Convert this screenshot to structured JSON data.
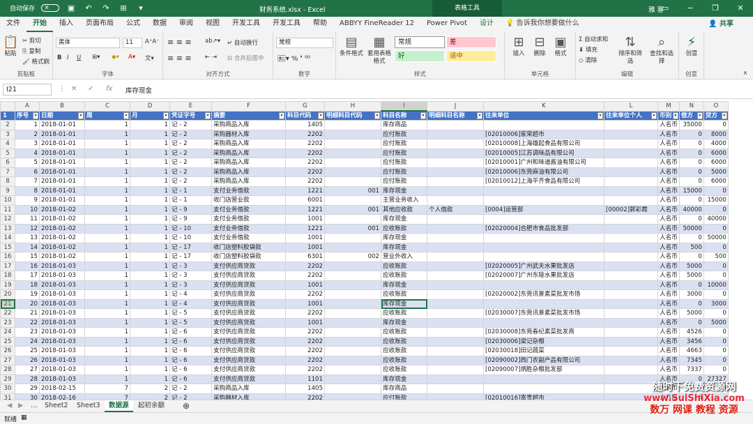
{
  "titlebar": {
    "autosave": "自动保存",
    "autosave_state": "关",
    "title": "财务系统.xlsx - Excel",
    "context": "表格工具",
    "user": "雅 客"
  },
  "tabs": [
    "文件",
    "开始",
    "插入",
    "页面布局",
    "公式",
    "数据",
    "审阅",
    "视图",
    "开发工具",
    "开发工具",
    "帮助",
    "ABBYY FineReader 12",
    "Power Pivot",
    "设计"
  ],
  "tellme": "告诉我你想要做什么",
  "share": "共享",
  "ribbon": {
    "clipboard": {
      "label": "剪贴板",
      "paste": "粘贴",
      "cut": "剪切",
      "copy": "复制",
      "painter": "格式刷"
    },
    "font": {
      "label": "字体",
      "name": "黑体",
      "size": "11",
      "bold": "B",
      "italic": "I",
      "underline": "U"
    },
    "align": {
      "label": "对齐方式",
      "wrap": "自动换行",
      "merge": "合并后居中"
    },
    "number": {
      "label": "数字",
      "format": "常规"
    },
    "styles": {
      "label": "样式",
      "cond": "条件格式",
      "table": "套用表格格式",
      "normal": "常规",
      "bad": "差",
      "good": "好",
      "neutral": "适中"
    },
    "cells": {
      "label": "单元格",
      "insert": "插入",
      "delete": "删除",
      "format": "格式"
    },
    "edit": {
      "label": "编辑",
      "autosum": "自动求和",
      "fill": "填充",
      "clear": "清除",
      "sort": "排序和筛选",
      "find": "查找和选择"
    },
    "idea": {
      "label": "创意",
      "btn": "创意"
    }
  },
  "formula": {
    "namebox": "I21",
    "content": "库存现金"
  },
  "columns": [
    "A",
    "B",
    "C",
    "D",
    "E",
    "F",
    "G",
    "H",
    "I",
    "J",
    "K",
    "L",
    "M",
    "N",
    "O"
  ],
  "selected_col": "I",
  "selected_row": 21,
  "headers": [
    "序号",
    "日期",
    "周",
    "月",
    "凭证字号",
    "摘要",
    "科目代码",
    "明细科目代码",
    "科目名称",
    "明细科目名称",
    "往来单位",
    "往来单位个人",
    "币别",
    "借方",
    "贷方"
  ],
  "rows": [
    [
      "1",
      "2018-01-01",
      "1",
      "1",
      "记 - 2",
      "采购商品入库",
      "1405",
      "",
      "库存商品",
      "",
      "",
      "",
      "人名币",
      "35000",
      "0"
    ],
    [
      "2",
      "2018-01-01",
      "1",
      "1",
      "记 - 2",
      "采购器材入库",
      "2202",
      "",
      "应付账款",
      "",
      "[02010006]家荣超市",
      "",
      "人名币",
      "0",
      "8000"
    ],
    [
      "3",
      "2018-01-01",
      "1",
      "1",
      "记 - 2",
      "采购商品入库",
      "2202",
      "",
      "应付账款",
      "",
      "[02010008]上海雄起食品有限公司",
      "",
      "人名币",
      "0",
      "4000"
    ],
    [
      "4",
      "2018-01-01",
      "1",
      "1",
      "记 - 2",
      "采购商品入库",
      "2202",
      "",
      "应付账款",
      "",
      "[02010005]江苏调味品有限公司",
      "",
      "人名币",
      "0",
      "6000"
    ],
    [
      "5",
      "2018-01-01",
      "1",
      "1",
      "记 - 2",
      "采购商品入库",
      "2202",
      "",
      "应付账款",
      "",
      "[02010001]广州和味道酱油有限公司",
      "",
      "人名币",
      "0",
      "6000"
    ],
    [
      "6",
      "2018-01-01",
      "1",
      "1",
      "记 - 2",
      "采购商品入库",
      "2202",
      "",
      "应付账款",
      "",
      "[02010006]东莞麻油有限公司",
      "",
      "人名币",
      "0",
      "5000"
    ],
    [
      "7",
      "2018-01-01",
      "1",
      "1",
      "记 - 2",
      "采购商品入库",
      "2202",
      "",
      "应付账款",
      "",
      "[02010012]上海平齐食品有限公司",
      "",
      "人名币",
      "0",
      "6000"
    ],
    [
      "8",
      "2018-01-01",
      "1",
      "1",
      "记 - 1",
      "支付业务借款",
      "1221",
      "001",
      "库存现金",
      "",
      "",
      "",
      "人名币",
      "15000",
      "0"
    ],
    [
      "9",
      "2018-01-01",
      "1",
      "1",
      "记 - 1",
      "收门店营业款",
      "6001",
      "",
      "主营业务收入",
      "",
      "",
      "",
      "人名币",
      "0",
      "15000"
    ],
    [
      "10",
      "2018-01-02",
      "1",
      "1",
      "记 - 9",
      "支付业务借款",
      "1221",
      "001",
      "其他应收款",
      "个人借款",
      "[0004]运营部",
      "[00002]郭彩霞",
      "人名币",
      "40000",
      "0"
    ],
    [
      "11",
      "2018-01-02",
      "1",
      "1",
      "记 - 9",
      "支付业务借款",
      "1001",
      "",
      "库存现金",
      "",
      "",
      "",
      "人名币",
      "0",
      "40000"
    ],
    [
      "12",
      "2018-01-02",
      "1",
      "1",
      "记 - 10",
      "支付业务借款",
      "1221",
      "001",
      "应收账款",
      "",
      "[02020004]合肥市食品批发部",
      "",
      "人名币",
      "50000",
      "0"
    ],
    [
      "13",
      "2018-01-02",
      "1",
      "1",
      "记 - 10",
      "支付业务借款",
      "1001",
      "",
      "库存现金",
      "",
      "",
      "",
      "人名币",
      "0",
      "50000"
    ],
    [
      "14",
      "2018-01-02",
      "1",
      "1",
      "记 - 17",
      "收门店塑料胶袋款",
      "1001",
      "",
      "库存现金",
      "",
      "",
      "",
      "人名币",
      "500",
      "0"
    ],
    [
      "15",
      "2018-01-02",
      "1",
      "1",
      "记 - 17",
      "收门店塑料胶袋款",
      "6301",
      "002",
      "营业外收入",
      "",
      "",
      "",
      "人名币",
      "0",
      "500"
    ],
    [
      "16",
      "2018-01-03",
      "1",
      "1",
      "记 - 3",
      "支付供应商贷款",
      "2202",
      "",
      "应收账款",
      "",
      "[02020005]广州武夫水果批发店",
      "",
      "人名币",
      "5000",
      "0"
    ],
    [
      "17",
      "2018-01-03",
      "1",
      "1",
      "记 - 3",
      "支付供应商贷款",
      "2202",
      "",
      "应收账款",
      "",
      "[02020007]广州东陵水果批发店",
      "",
      "人名币",
      "5000",
      "0"
    ],
    [
      "18",
      "2018-01-03",
      "1",
      "1",
      "记 - 3",
      "支付供应商贷款",
      "1001",
      "",
      "库存现金",
      "",
      "",
      "",
      "人名币",
      "0",
      "10000"
    ],
    [
      "19",
      "2018-01-03",
      "1",
      "1",
      "记 - 4",
      "支付供应商贷款",
      "2202",
      "",
      "应收账款",
      "",
      "[02020002]东莞讯景素菜批发市场",
      "",
      "人名币",
      "3000",
      "0"
    ],
    [
      "20",
      "2018-01-03",
      "1",
      "1",
      "记 - 4",
      "支付供应商贷款",
      "1001",
      "",
      "库存现金",
      "",
      "",
      "",
      "人名币",
      "0",
      "3000"
    ],
    [
      "21",
      "2018-01-03",
      "1",
      "1",
      "记 - 5",
      "支付供应商贷款",
      "2202",
      "",
      "应收账款",
      "",
      "[02030007]东莞讯景素菜批发市场",
      "",
      "人名币",
      "5000",
      "0"
    ],
    [
      "22",
      "2018-01-03",
      "1",
      "1",
      "记 - 5",
      "支付供应商贷款",
      "1001",
      "",
      "库存现金",
      "",
      "",
      "",
      "人名币",
      "0",
      "5000"
    ],
    [
      "23",
      "2018-01-03",
      "1",
      "1",
      "记 - 6",
      "支付供应商贷款",
      "2202",
      "",
      "应收账款",
      "",
      "[02030008]东莞春纪素菜批发商",
      "",
      "人名币",
      "4526",
      "0"
    ],
    [
      "24",
      "2018-01-03",
      "1",
      "1",
      "记 - 6",
      "支付供应商贷款",
      "2202",
      "",
      "应收账款",
      "",
      "[02030006]梁记杂粮",
      "",
      "人名币",
      "3456",
      "0"
    ],
    [
      "25",
      "2018-01-03",
      "1",
      "1",
      "记 - 6",
      "支付供应商贷款",
      "2202",
      "",
      "应收账款",
      "",
      "[02030018]田记蔬菜",
      "",
      "人名币",
      "4663",
      "0"
    ],
    [
      "26",
      "2018-01-03",
      "1",
      "1",
      "记 - 6",
      "支付供应商贷款",
      "2202",
      "",
      "应收账款",
      "",
      "[02090002]西门农副产品有限公司",
      "",
      "人名币",
      "7345",
      "0"
    ],
    [
      "27",
      "2018-01-03",
      "1",
      "1",
      "记 - 6",
      "支付供应商贷款",
      "2202",
      "",
      "应收账款",
      "",
      "[02090007]炳胜杂粮批发部",
      "",
      "人名币",
      "7337",
      "0"
    ],
    [
      "28",
      "2018-01-03",
      "1",
      "1",
      "记 - 6",
      "支付供应商贷款",
      "1101",
      "",
      "库存现金",
      "",
      "",
      "",
      "人名币",
      "0",
      "27327"
    ],
    [
      "29",
      "2018-02-15",
      "7",
      "2",
      "记 - 2",
      "采购商品入库",
      "1405",
      "",
      "库存商品",
      "",
      "",
      "",
      "人名币",
      "",
      "0"
    ],
    [
      "30",
      "2018-02-16",
      "7",
      "2",
      "记 - 2",
      "采购器材入库",
      "2202",
      "",
      "应付账款",
      "",
      "[02010016]富贵超市",
      "",
      "人名币",
      "0",
      ""
    ]
  ],
  "sheets": [
    "Sheet2",
    "Sheet3",
    "数据源",
    "起初余额"
  ],
  "active_sheet": "数据源",
  "status": "就绪",
  "watermark": {
    "line1": "随时下免费资源网",
    "line2": "www.SuiShiXia.com",
    "line3": "数万 网课 教程 资源"
  }
}
